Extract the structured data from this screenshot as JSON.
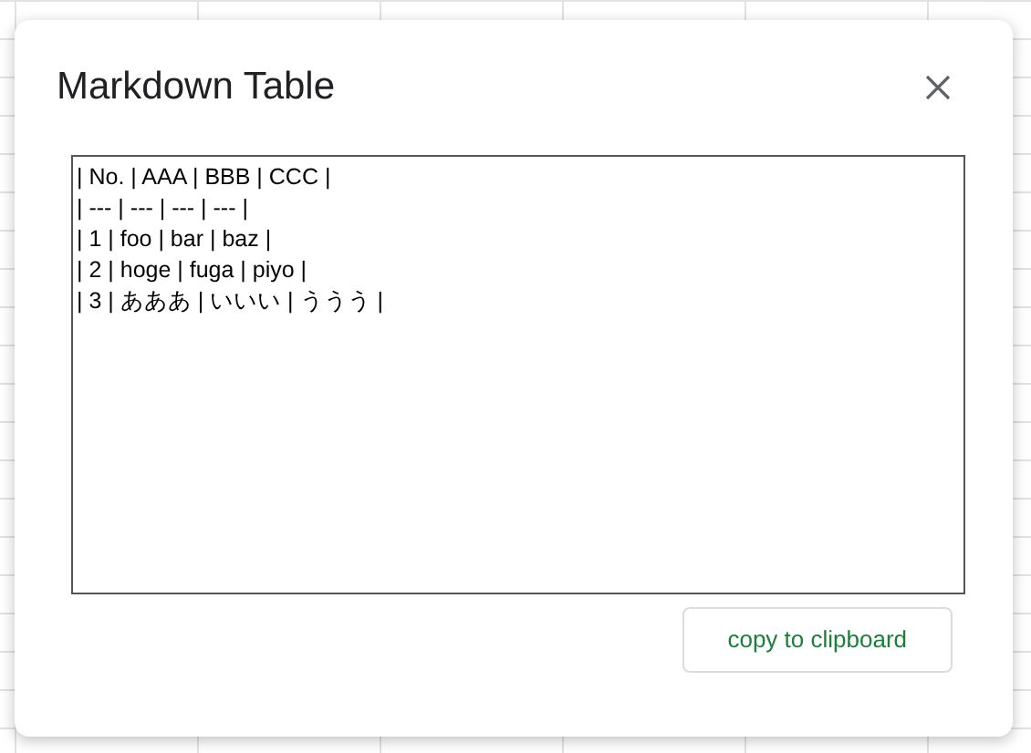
{
  "dialog": {
    "title": "Markdown Table",
    "textarea": {
      "value": "| No. | AAA | BBB | CCC |\n| --- | --- | --- | --- |\n| 1 | foo | bar | baz |\n| 2 | hoge | fuga | piyo |\n| 3 | あああ | いいい | ううう |"
    },
    "buttons": [
      "copy to clipboard"
    ]
  }
}
